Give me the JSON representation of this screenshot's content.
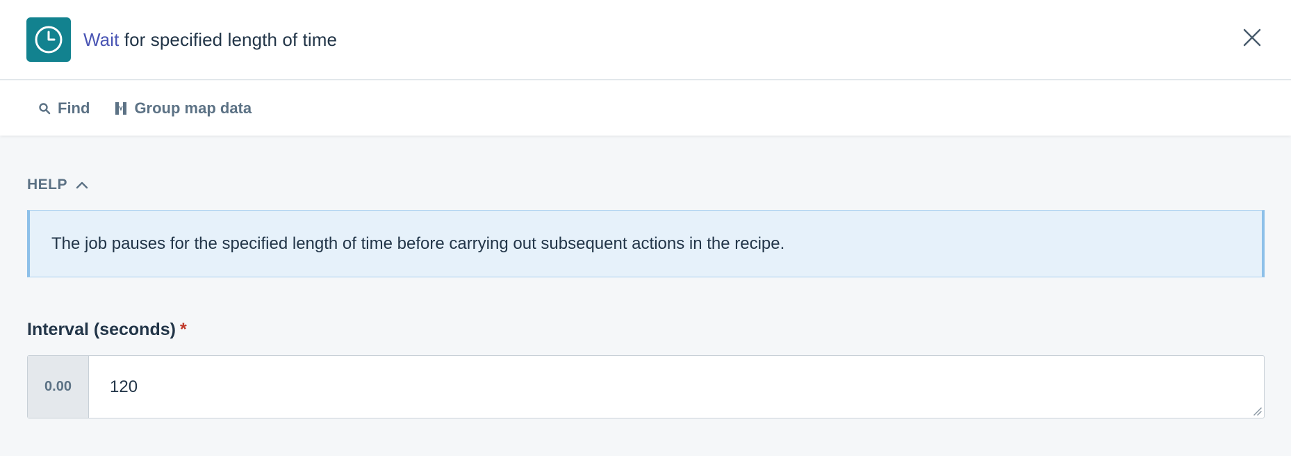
{
  "header": {
    "icon": "clock-icon",
    "title_verb": "Wait",
    "title_rest": " for specified length of time",
    "close_icon": "close-icon",
    "accent": "#12828f"
  },
  "toolbar": {
    "find_label": "Find",
    "find_icon": "search-icon",
    "group_label": "Group map data",
    "group_icon": "group-map-icon"
  },
  "help": {
    "toggle_label": "HELP",
    "toggle_icon": "chevron-up-icon",
    "text": "The job pauses for the specified length of time before carrying out subsequent actions in the recipe."
  },
  "interval_field": {
    "label": "Interval (seconds)",
    "required_mark": "*",
    "type_badge": "0.00",
    "value": "120"
  }
}
